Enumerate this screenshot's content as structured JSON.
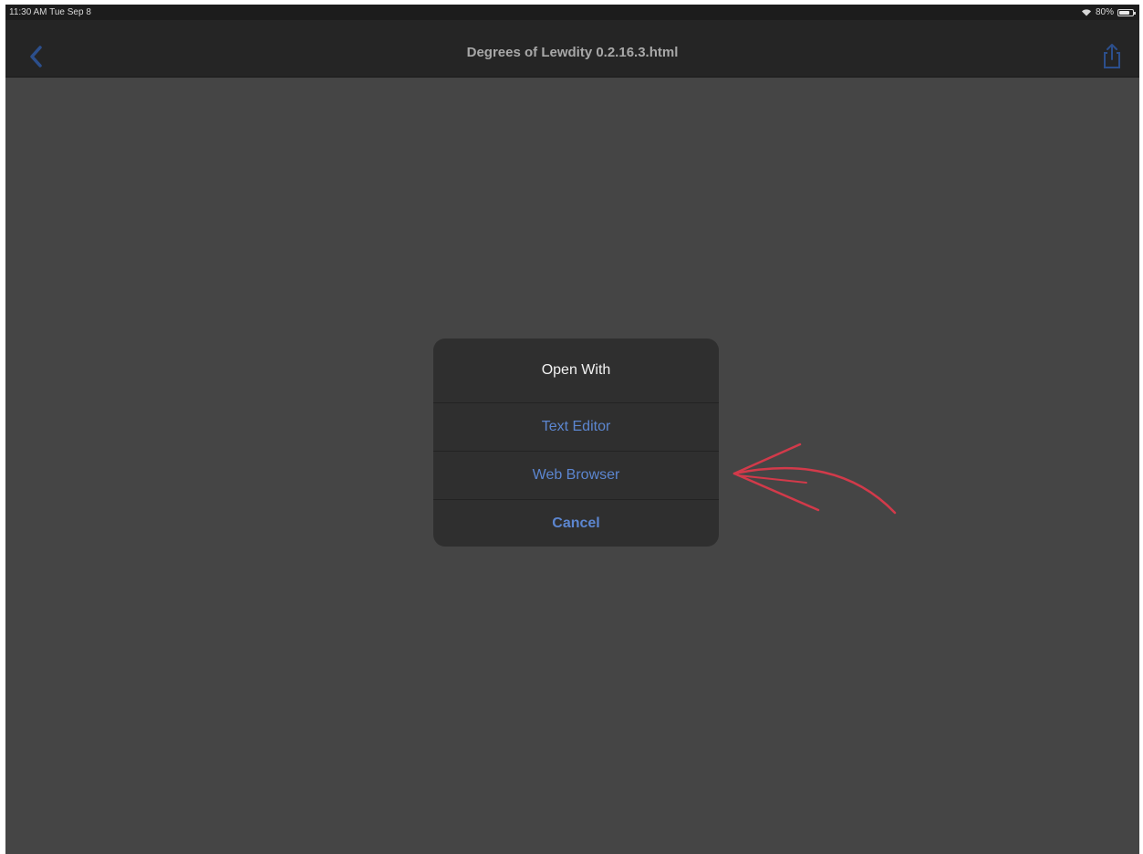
{
  "status_bar": {
    "time_date": "11:30 AM  Tue Sep 8",
    "battery": "80%",
    "battery_level": 0.8,
    "icons": [
      "wifi-icon",
      "battery-icon"
    ]
  },
  "nav": {
    "title": "Degrees of Lewdity 0.2.16.3.html",
    "back_icon": "chevron-left-icon",
    "share_icon": "share-icon"
  },
  "dialog": {
    "title": "Open With",
    "actions": [
      {
        "label": "Text Editor"
      },
      {
        "label": "Web Browser"
      },
      {
        "label": "Cancel"
      }
    ]
  },
  "colors": {
    "accent": "#5c86d0",
    "annotation": "#d23a4a",
    "background": "#454545",
    "navbar": "#252525",
    "dialog": "#2f2f2f"
  }
}
